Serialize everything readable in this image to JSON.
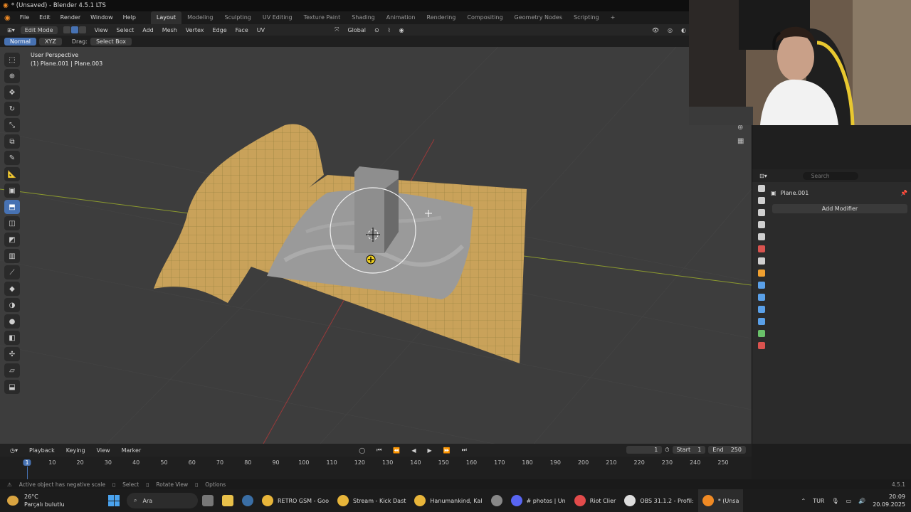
{
  "window": {
    "title": "* (Unsaved) - Blender 4.5.1 LTS"
  },
  "menu": [
    "File",
    "Edit",
    "Render",
    "Window",
    "Help"
  ],
  "workspaces": [
    "Layout",
    "Modeling",
    "Sculpting",
    "UV Editing",
    "Texture Paint",
    "Shading",
    "Animation",
    "Rendering",
    "Compositing",
    "Geometry Nodes",
    "Scripting",
    "+"
  ],
  "active_workspace": "Layout",
  "header": {
    "mode": "Edit Mode",
    "menus": [
      "View",
      "Select",
      "Add",
      "Mesh",
      "Vertex",
      "Edge",
      "Face",
      "UV"
    ],
    "transform_orientation": "Global"
  },
  "tool_header": {
    "normal": "Normal",
    "xyz": "XYZ",
    "drag_label": "Drag:",
    "drag_value": "Select Box"
  },
  "viewport": {
    "perspective": "User Perspective",
    "object_info": "(1) Plane.001 | Plane.003"
  },
  "properties": {
    "search_placeholder": "Search",
    "object_name": "Plane.001",
    "add_modifier": "Add Modifier",
    "tab_colors": [
      "#cfcfcf",
      "#cfcfcf",
      "#cfcfcf",
      "#cfcfcf",
      "#cfcfcf",
      "#d9534f",
      "#cfcfcf",
      "#f0a030",
      "#5aa0e8",
      "#5aa0e8",
      "#5aa0e8",
      "#5aa0e8",
      "#6ac16a",
      "#d9534f"
    ]
  },
  "timeline": {
    "menus": [
      "Playback",
      "Keying",
      "View",
      "Marker"
    ],
    "current_frame": "1",
    "start_label": "Start",
    "start": "1",
    "end_label": "End",
    "end": "250",
    "ticks": [
      "1",
      "10",
      "20",
      "30",
      "40",
      "50",
      "60",
      "70",
      "80",
      "90",
      "100",
      "110",
      "120",
      "130",
      "140",
      "150",
      "160",
      "170",
      "180",
      "190",
      "200",
      "210",
      "220",
      "230",
      "240",
      "250"
    ]
  },
  "status": {
    "warning": "Active object has negative scale",
    "select": "Select",
    "rotate": "Rotate View",
    "options": "Options",
    "version": "4.5.1"
  },
  "taskbar": {
    "weather_temp": "26°C",
    "weather_desc": "Parçalı bulutlu",
    "search": "Ara",
    "apps": [
      {
        "label": "RETRO GSM - Goo",
        "color": "#e8b53a"
      },
      {
        "label": "Stream - Kick Dast",
        "color": "#e8b53a"
      },
      {
        "label": "Hanumankind, Kal",
        "color": "#e8b53a"
      },
      {
        "label": "# photos | Un",
        "color": "#5865f2"
      },
      {
        "label": "Riot Clier",
        "color": "#e24b4b"
      },
      {
        "label": "OBS 31.1.2 - Profil:",
        "color": "#dddddd"
      },
      {
        "label": "* (Unsa",
        "color": "#f08a24"
      }
    ],
    "lang": "TUR",
    "time": "20:09",
    "date": "20.09.2025"
  }
}
